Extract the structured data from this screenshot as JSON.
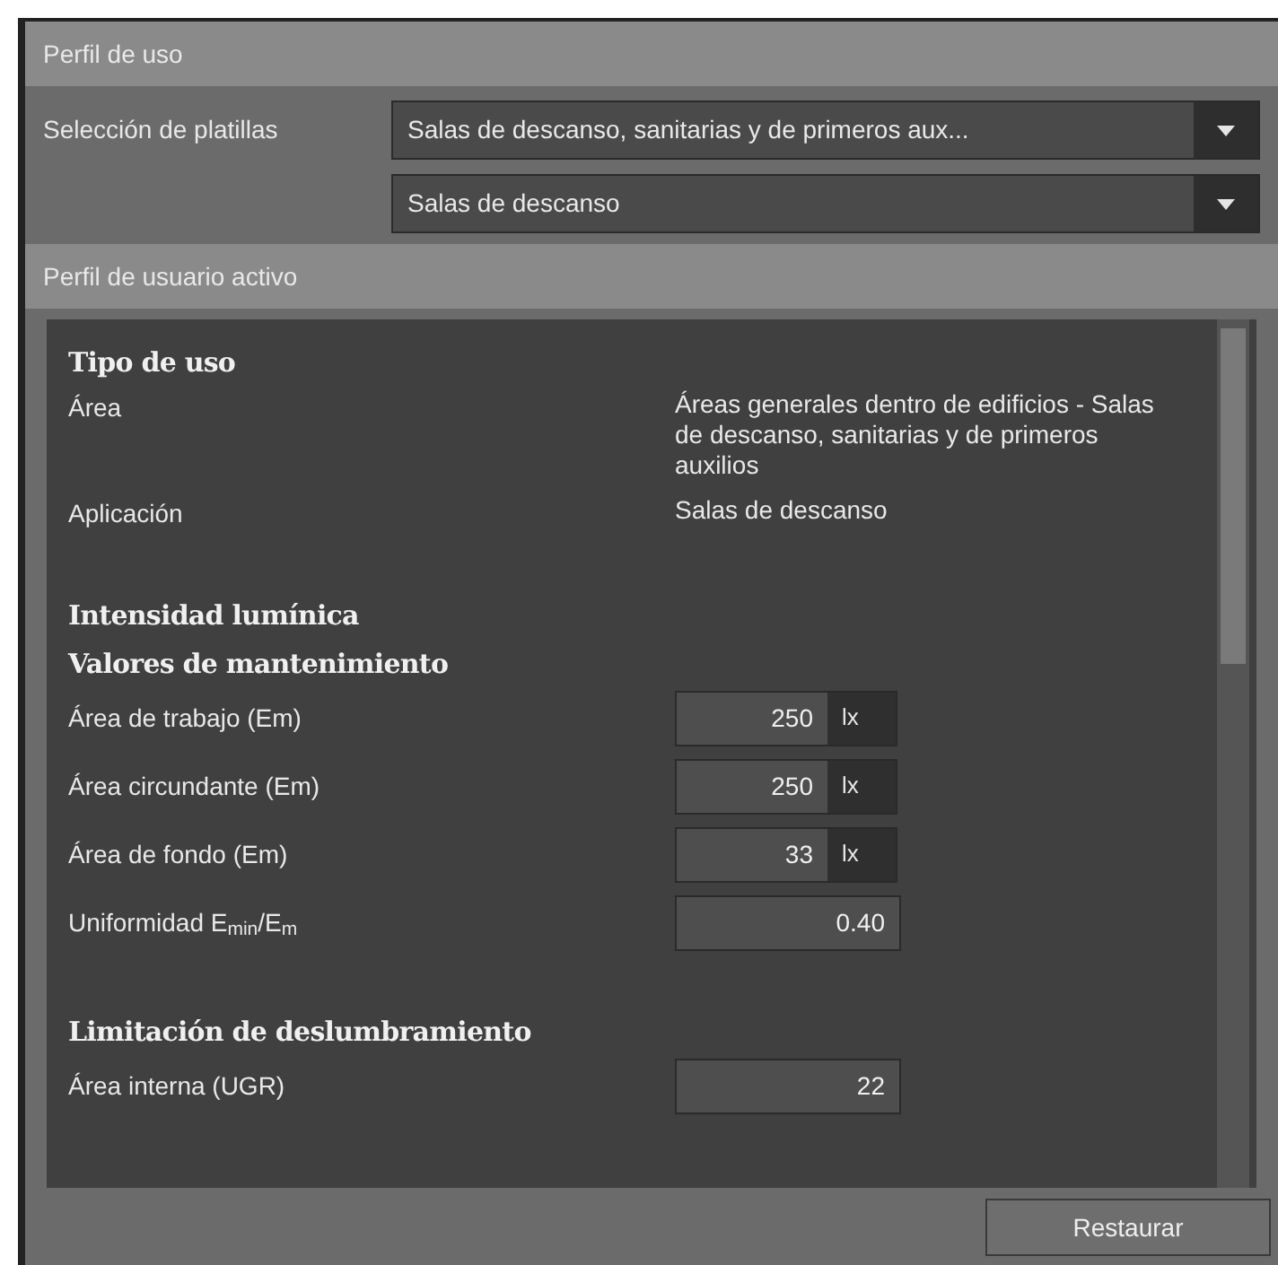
{
  "header": {
    "title": "Perfil de uso"
  },
  "template_selection": {
    "label": "Selección de platillas",
    "dropdowns": [
      {
        "value": "Salas de descanso, sanitarias y de primeros aux..."
      },
      {
        "value": "Salas de descanso"
      }
    ]
  },
  "active_profile": {
    "title": "Perfil de usuario activo",
    "rows": [
      {
        "kind": "heading",
        "label": "Tipo de uso"
      },
      {
        "kind": "info",
        "label": "Área",
        "value": "Áreas generales dentro de edificios - Salas de descanso, sanitarias y de primeros auxilios"
      },
      {
        "kind": "info",
        "label": "Aplicación",
        "value": "Salas de descanso"
      },
      {
        "kind": "spacer"
      },
      {
        "kind": "heading",
        "label": "Intensidad lumínica"
      },
      {
        "kind": "heading",
        "label": "Valores de mantenimiento"
      },
      {
        "kind": "field",
        "label": "Área de trabajo (Em)",
        "value": "250",
        "unit": "lx"
      },
      {
        "kind": "field",
        "label": "Área circundante (Em)",
        "value": "250",
        "unit": "lx"
      },
      {
        "kind": "field",
        "label": "Área de fondo (Em)",
        "value": "33",
        "unit": "lx"
      },
      {
        "kind": "field",
        "label": "Uniformidad E$_{min}$/E$_{m}$",
        "value": "0.40"
      },
      {
        "kind": "spacer"
      },
      {
        "kind": "heading",
        "label": "Limitación de deslumbramiento"
      },
      {
        "kind": "field",
        "label": "Área interna (UGR)",
        "value": "22"
      }
    ]
  },
  "restore_button": {
    "label": "Restaurar"
  }
}
